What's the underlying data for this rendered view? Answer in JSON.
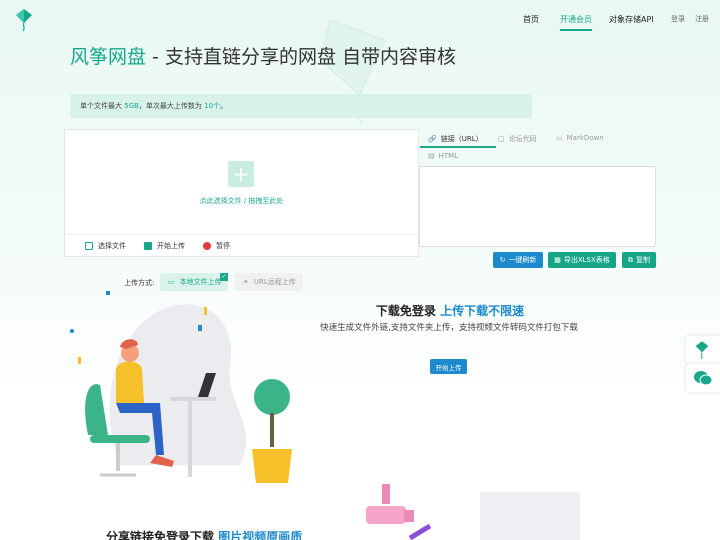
{
  "header": {
    "nav": [
      "首页",
      "开通会员",
      "对象存储API"
    ],
    "auth": {
      "login": "登录",
      "register": "注册"
    }
  },
  "hero": {
    "brand": "风筝网盘",
    "title_rest": " - 支持直链分享的网盘 自带内容审核"
  },
  "notice": {
    "p1": "单个文件最大 ",
    "size": "5GB",
    "p2": "，单次最大上传数为 ",
    "count": "10个",
    "p3": "。"
  },
  "upload": {
    "hint": "点此选择文件 / 拖拽至此处",
    "actions": [
      "选择文件",
      "开始上传",
      "暂停"
    ]
  },
  "link_tabs": [
    "链接（URL）",
    "论坛代码",
    "MarkDown",
    "HTML"
  ],
  "buttons": {
    "refresh": "一键刷新",
    "export": "导出XLSX表格",
    "copy": "复制"
  },
  "mode": {
    "label": "上传方式:",
    "local": "本地文件上传",
    "url": "URL远程上传"
  },
  "promo": {
    "title_a": "下载免登录 ",
    "title_b": "上传下载不限速",
    "desc": "快速生成文件外链,支持文件夹上传，支持视频文件转码文件打包下载",
    "start": "开始上传"
  },
  "bottom": {
    "title_a": "分享链接免登录下载 ",
    "title_b": "图片视频原画质"
  },
  "colors": {
    "accent": "#17a78a",
    "blue": "#1d8acb"
  }
}
